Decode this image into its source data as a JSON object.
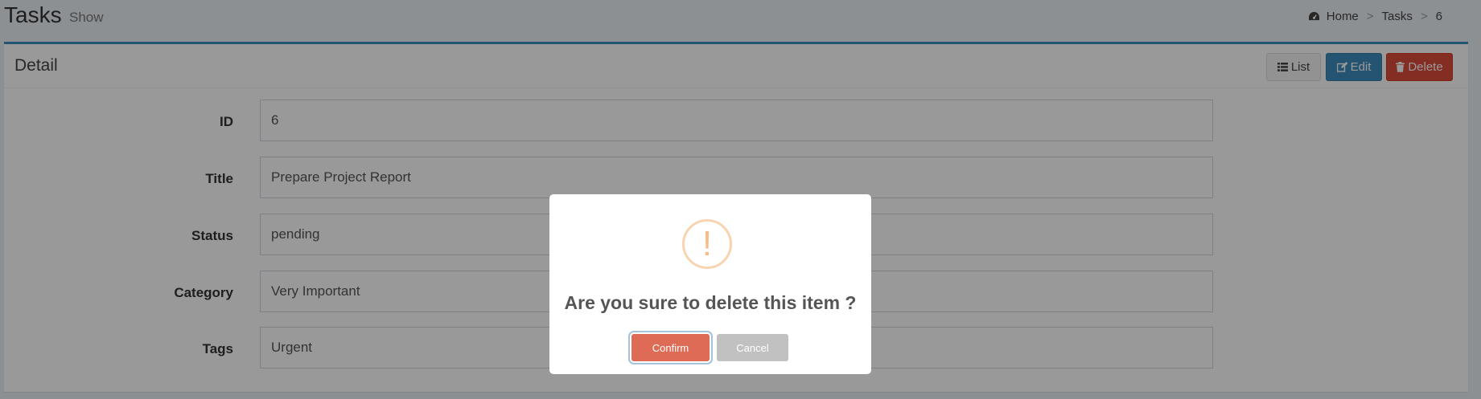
{
  "header": {
    "title": "Tasks",
    "subtitle": "Show",
    "breadcrumb": [
      "Home",
      "Tasks",
      "6"
    ],
    "breadcrumb_sep": ">"
  },
  "panel": {
    "title": "Detail",
    "buttons": {
      "list": "List",
      "edit": "Edit",
      "delete": "Delete"
    }
  },
  "fields": [
    {
      "label": "ID",
      "value": "6"
    },
    {
      "label": "Title",
      "value": "Prepare Project Report"
    },
    {
      "label": "Status",
      "value": "pending"
    },
    {
      "label": "Category",
      "value": "Very Important"
    },
    {
      "label": "Tags",
      "value": "Urgent"
    }
  ],
  "dialog": {
    "icon": "!",
    "message": "Are you sure to delete this item ?",
    "confirm": "Confirm",
    "cancel": "Cancel"
  },
  "colors": {
    "primary": "#3c8dbc",
    "danger": "#dd4b39",
    "confirm": "#dd6b55",
    "warning_icon": "#f8bb86"
  }
}
